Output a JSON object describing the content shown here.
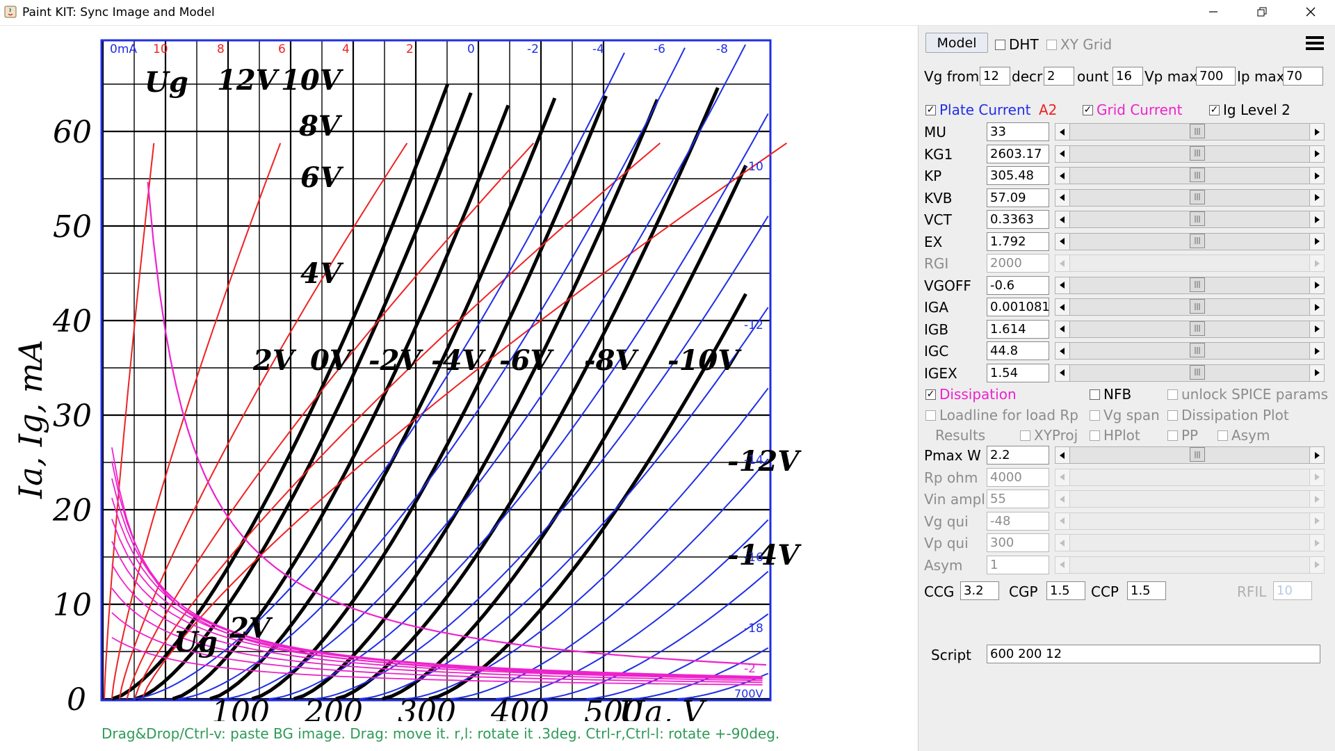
{
  "window": {
    "title": "Paint KIT: Sync Image and Model"
  },
  "status_text": "Drag&Drop/Ctrl-v: paste BG image. Drag: move it. r,l: rotate it .3deg. Ctrl-r,Ctrl-l: rotate +-90deg.",
  "chart": {
    "y_axis_label": "Ia, Ig, mA",
    "x_axis_label": "Ua, V",
    "y_ticks": [
      "0",
      "10",
      "20",
      "30",
      "40",
      "50",
      "60"
    ],
    "x_ticks": [
      "100",
      "200",
      "300",
      "400",
      "500"
    ],
    "curve_labels": [
      "Ug",
      "12V",
      "10V",
      "8V",
      "6V",
      "4V",
      "2V",
      "0V",
      "-2V",
      "-4V",
      "-6V",
      "-8V",
      "-10V",
      "-12V",
      "-14V",
      "Ug",
      "2V"
    ],
    "overlay_top_labels": [
      "0mA",
      "10",
      "8",
      "6",
      "4",
      "2",
      "0",
      "-2",
      "-4",
      "-6",
      "-8"
    ],
    "overlay_right_labels": [
      "-10",
      "-12",
      "-14",
      "-16",
      "-18",
      "-2"
    ],
    "overlay_corner_label": "700V"
  },
  "panel": {
    "model_button": "Model",
    "dht": "DHT",
    "xy_grid": "XY Grid",
    "vg_from_label": "Vg from",
    "vg_from": "12",
    "decr_label": "decr",
    "decr": "2",
    "count_label": "ount",
    "count": "16",
    "vp_max_label": "Vp max",
    "vp_max": "700",
    "ip_max_label": "Ip max",
    "ip_max": "70",
    "plate_current": "Plate Current",
    "a2": "A2",
    "grid_current": "Grid Current",
    "ig_level": "Ig Level 2",
    "params": [
      {
        "name": "MU",
        "value": "33",
        "pos": 0.5,
        "enabled": true
      },
      {
        "name": "KG1",
        "value": "2603.17",
        "pos": 0.5,
        "enabled": true
      },
      {
        "name": "KP",
        "value": "305.48",
        "pos": 0.5,
        "enabled": true
      },
      {
        "name": "KVB",
        "value": "57.09",
        "pos": 0.5,
        "enabled": true
      },
      {
        "name": "VCT",
        "value": "0.3363",
        "pos": 0.5,
        "enabled": true
      },
      {
        "name": "EX",
        "value": "1.792",
        "pos": 0.5,
        "enabled": true
      },
      {
        "name": "RGI",
        "value": "2000",
        "pos": 0.5,
        "enabled": false
      },
      {
        "name": "VGOFF",
        "value": "-0.6",
        "pos": 0.5,
        "enabled": true
      },
      {
        "name": "IGA",
        "value": "0.001081",
        "pos": 0.5,
        "enabled": true
      },
      {
        "name": "IGB",
        "value": "1.614",
        "pos": 0.5,
        "enabled": true
      },
      {
        "name": "IGC",
        "value": "44.8",
        "pos": 0.5,
        "enabled": true
      },
      {
        "name": "IGEX",
        "value": "1.54",
        "pos": 0.5,
        "enabled": true
      }
    ],
    "dissipation": "Dissipation",
    "nfb": "NFB",
    "unlock_spice": "unlock SPICE params",
    "loadline": "Loadline for load Rp",
    "vg_span": "Vg span",
    "dissipation_plot": "Dissipation Plot",
    "results": "Results",
    "xyproj": "XYProj",
    "hplot": "HPlot",
    "pp": "PP",
    "asym_cb": "Asym",
    "load_params": [
      {
        "name": "Pmax W",
        "value": "2.2",
        "pos": 0.5,
        "enabled": true
      },
      {
        "name": "Rp ohm",
        "value": "4000",
        "pos": 0,
        "enabled": false
      },
      {
        "name": "Vin ampl",
        "value": "55",
        "pos": 0,
        "enabled": false
      },
      {
        "name": "Vg qui",
        "value": "-48",
        "pos": 0,
        "enabled": false
      },
      {
        "name": "Vp qui",
        "value": "300",
        "pos": 0,
        "enabled": false
      },
      {
        "name": "Asym",
        "value": "1",
        "pos": 0,
        "enabled": false
      }
    ],
    "ccg_label": "CCG",
    "ccg": "3.2",
    "cgp_label": "CGP",
    "cgp": "1.5",
    "ccp_label": "CCP",
    "ccp": "1.5",
    "rfil_label": "RFIL",
    "rfil": "10",
    "script_label": "Script",
    "script": "600 200 12"
  },
  "colors": {
    "plate": "#1f2ee6",
    "grid": "#ee2222",
    "dissipation": "#ee22cc",
    "status": "#2e9a57"
  }
}
